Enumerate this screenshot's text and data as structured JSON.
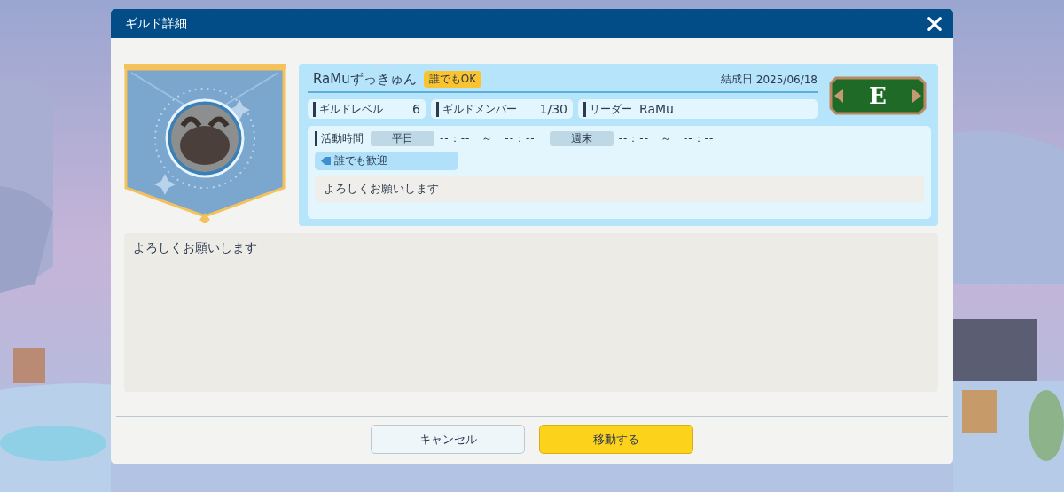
{
  "dialog": {
    "title": "ギルド詳細"
  },
  "guild": {
    "name": "RaMuずっきゅん",
    "join_badge": "誰でもOK",
    "founded_label": "結成日",
    "founded_date": "2025/06/18",
    "rank": "E",
    "stats": [
      {
        "label": "ギルドレベル",
        "value": "6"
      },
      {
        "label": "ギルドメンバー",
        "value": "1/30"
      },
      {
        "label": "リーダー",
        "value": "RaMu"
      }
    ],
    "activity": {
      "label": "活動時間",
      "periods": [
        {
          "label": "平日",
          "time": "--：--　～　--：--"
        },
        {
          "label": "週末",
          "time": "--：--　～　--：--"
        }
      ]
    },
    "tags": [
      "誰でも歓迎"
    ],
    "short_message": "よろしくお願いします"
  },
  "message": "よろしくお願いします",
  "buttons": [
    {
      "label": "キャンセル",
      "kind": "secondary"
    },
    {
      "label": "移動する",
      "kind": "primary"
    }
  ]
}
